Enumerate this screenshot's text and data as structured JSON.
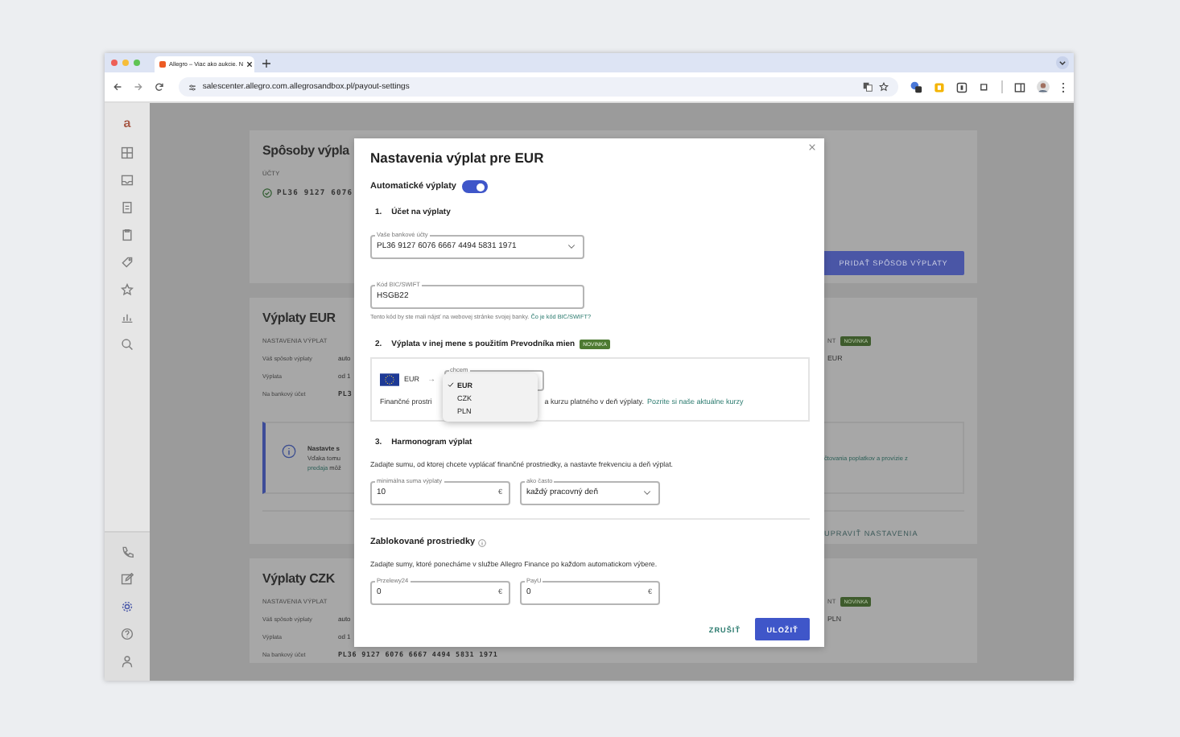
{
  "browser": {
    "tab_title": "Allegro – Viac ako aukcie. N",
    "url": "salescenter.allegro.com.allegrosandbox.pl/payout-settings"
  },
  "sidebar": {
    "logo": "a",
    "top_items": [
      {
        "kind": "grid",
        "selected": false
      },
      {
        "kind": "inbox",
        "selected": false
      },
      {
        "kind": "document",
        "selected": false
      },
      {
        "kind": "clipboard",
        "selected": false
      },
      {
        "kind": "tag",
        "selected": false
      },
      {
        "kind": "star",
        "selected": false
      },
      {
        "kind": "chart",
        "selected": false
      },
      {
        "kind": "search",
        "selected": false
      }
    ],
    "bottom_items": [
      {
        "kind": "phone",
        "selected": false
      },
      {
        "kind": "edit",
        "selected": false
      },
      {
        "kind": "settings",
        "selected": true
      },
      {
        "kind": "help",
        "selected": false
      },
      {
        "kind": "person",
        "selected": false
      }
    ]
  },
  "methods_card": {
    "title": "Spôsoby výpla",
    "section": "ÚČTY",
    "account": "PL36 9127 6076",
    "button": "PRIDAŤ SPÔSOB VÝPLATY"
  },
  "eur_card": {
    "title": "Výplaty EUR",
    "section": "NASTAVENIA VÝPLAT",
    "section_right": "NT",
    "badge": "NOVINKA",
    "rows": [
      {
        "label": "Váš spôsob výplaty",
        "value": "auto",
        "right": "EUR"
      },
      {
        "label": "Výplata",
        "value": "od 1"
      },
      {
        "label": "Na bankový účet",
        "value": "PL3"
      }
    ],
    "info": {
      "title": "Nastavte s",
      "text": "Vďaka tomu",
      "link": "predaja",
      "text_2": "môž",
      "link_right": "čtovania poplatkov a provízie z"
    },
    "action": "UPRAVIŤ NASTAVENIA"
  },
  "czk_card": {
    "title": "Výplaty CZK",
    "section": "NASTAVENIA VÝPLAT",
    "section_right": "NT",
    "badge": "NOVINKA",
    "rows": [
      {
        "label": "Váš spôsob výplaty",
        "value": "auto",
        "right": "PLN"
      },
      {
        "label": "Výplata",
        "value": "od 1"
      },
      {
        "label": "Na bankový účet",
        "value": "PL36 9127 6076 6667 4494 5831 1971"
      }
    ]
  },
  "modal": {
    "title": "Nastavenia výplat pre EUR",
    "auto_payouts": {
      "label": "Automatické výplaty",
      "on": true
    },
    "section_1": {
      "number": "1.",
      "title": "Účet na výplaty"
    },
    "account_select": {
      "label": "Vaše bankové účty",
      "value": "PL36 9127 6076 6667 4494 5831 1971"
    },
    "bic_field": {
      "label": "Kód BIC/SWIFT",
      "value": "HSGB22",
      "hint": "Tento kód by ste mali nájsť na webovej stránke svojej banky.",
      "hint_link": "Čo je kód BIC/SWIFT?"
    },
    "section_2": {
      "number": "2.",
      "title": "Výplata v inej mene s použitím Prevodníka mien",
      "badge": "NOVINKA"
    },
    "converter": {
      "from": "EUR",
      "arrow": "→",
      "select_label": "chcem",
      "options": [
        {
          "label": "EUR",
          "selected": true
        },
        {
          "label": "CZK",
          "selected": false
        },
        {
          "label": "PLN",
          "selected": false
        }
      ],
      "note_start": "Finančné prostri",
      "note_end": "a kurzu platného v deň výplaty.",
      "note_link": "Pozrite si naše aktuálne kurzy"
    },
    "section_3": {
      "number": "3.",
      "title": "Harmonogram výplat"
    },
    "schedule_text": "Zadajte sumu, od ktorej chcete vyplácať finančné prostriedky, a nastavte frekvenciu a deň výplat.",
    "min_amount": {
      "label": "minimálna suma výplaty",
      "value": "10",
      "unit": "€"
    },
    "frequency": {
      "label": "ako často",
      "value": "každý pracovný deň"
    },
    "blocked": {
      "title": "Zablokované prostriedky",
      "text": "Zadajte sumy, ktoré ponecháme v službe Allegro Finance po každom automatickom výbere.",
      "fields": [
        {
          "label": "Przelewy24",
          "value": "0",
          "unit": "€"
        },
        {
          "label": "PayU",
          "value": "0",
          "unit": "€"
        }
      ]
    },
    "buttons": {
      "cancel": "ZRUŠIŤ",
      "save": "ULOŽIŤ"
    }
  }
}
